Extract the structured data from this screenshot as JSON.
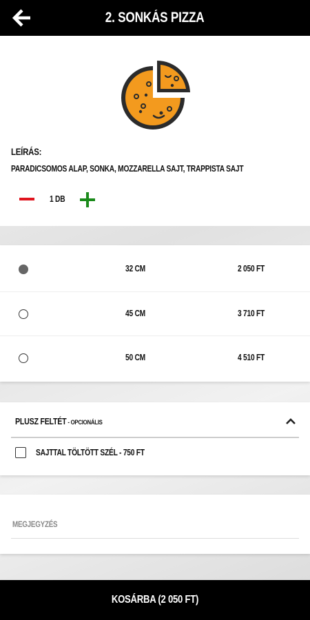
{
  "header": {
    "title": "2. Sonkás pizza",
    "back_icon": "arrow-left-icon"
  },
  "product": {
    "icon": "pizza-icon",
    "colors": {
      "cheese": "#f39a1e",
      "outline": "#2b2b2b"
    },
    "description_label": "Leírás:",
    "description": "Paradicsomos alap, sonka, mozzarella sajt, trappista sajt",
    "quantity": {
      "value": "1 db",
      "minus_color": "#e0141e",
      "plus_color": "#1a8a1a"
    }
  },
  "sizes": [
    {
      "name": "32 cm",
      "price": "2 050 Ft",
      "selected": true
    },
    {
      "name": "45 cm",
      "price": "3 710 Ft",
      "selected": false
    },
    {
      "name": "50 cm",
      "price": "4 510 Ft",
      "selected": false
    }
  ],
  "extras": {
    "title": "Plusz feltét",
    "subtitle": " - opcionális",
    "items": [
      {
        "label": "Sajttal töltött szél - 750 Ft",
        "checked": false
      }
    ]
  },
  "note": {
    "placeholder": "Megjegyzés"
  },
  "cart": {
    "label": "Kosárba (2 050 Ft)"
  }
}
